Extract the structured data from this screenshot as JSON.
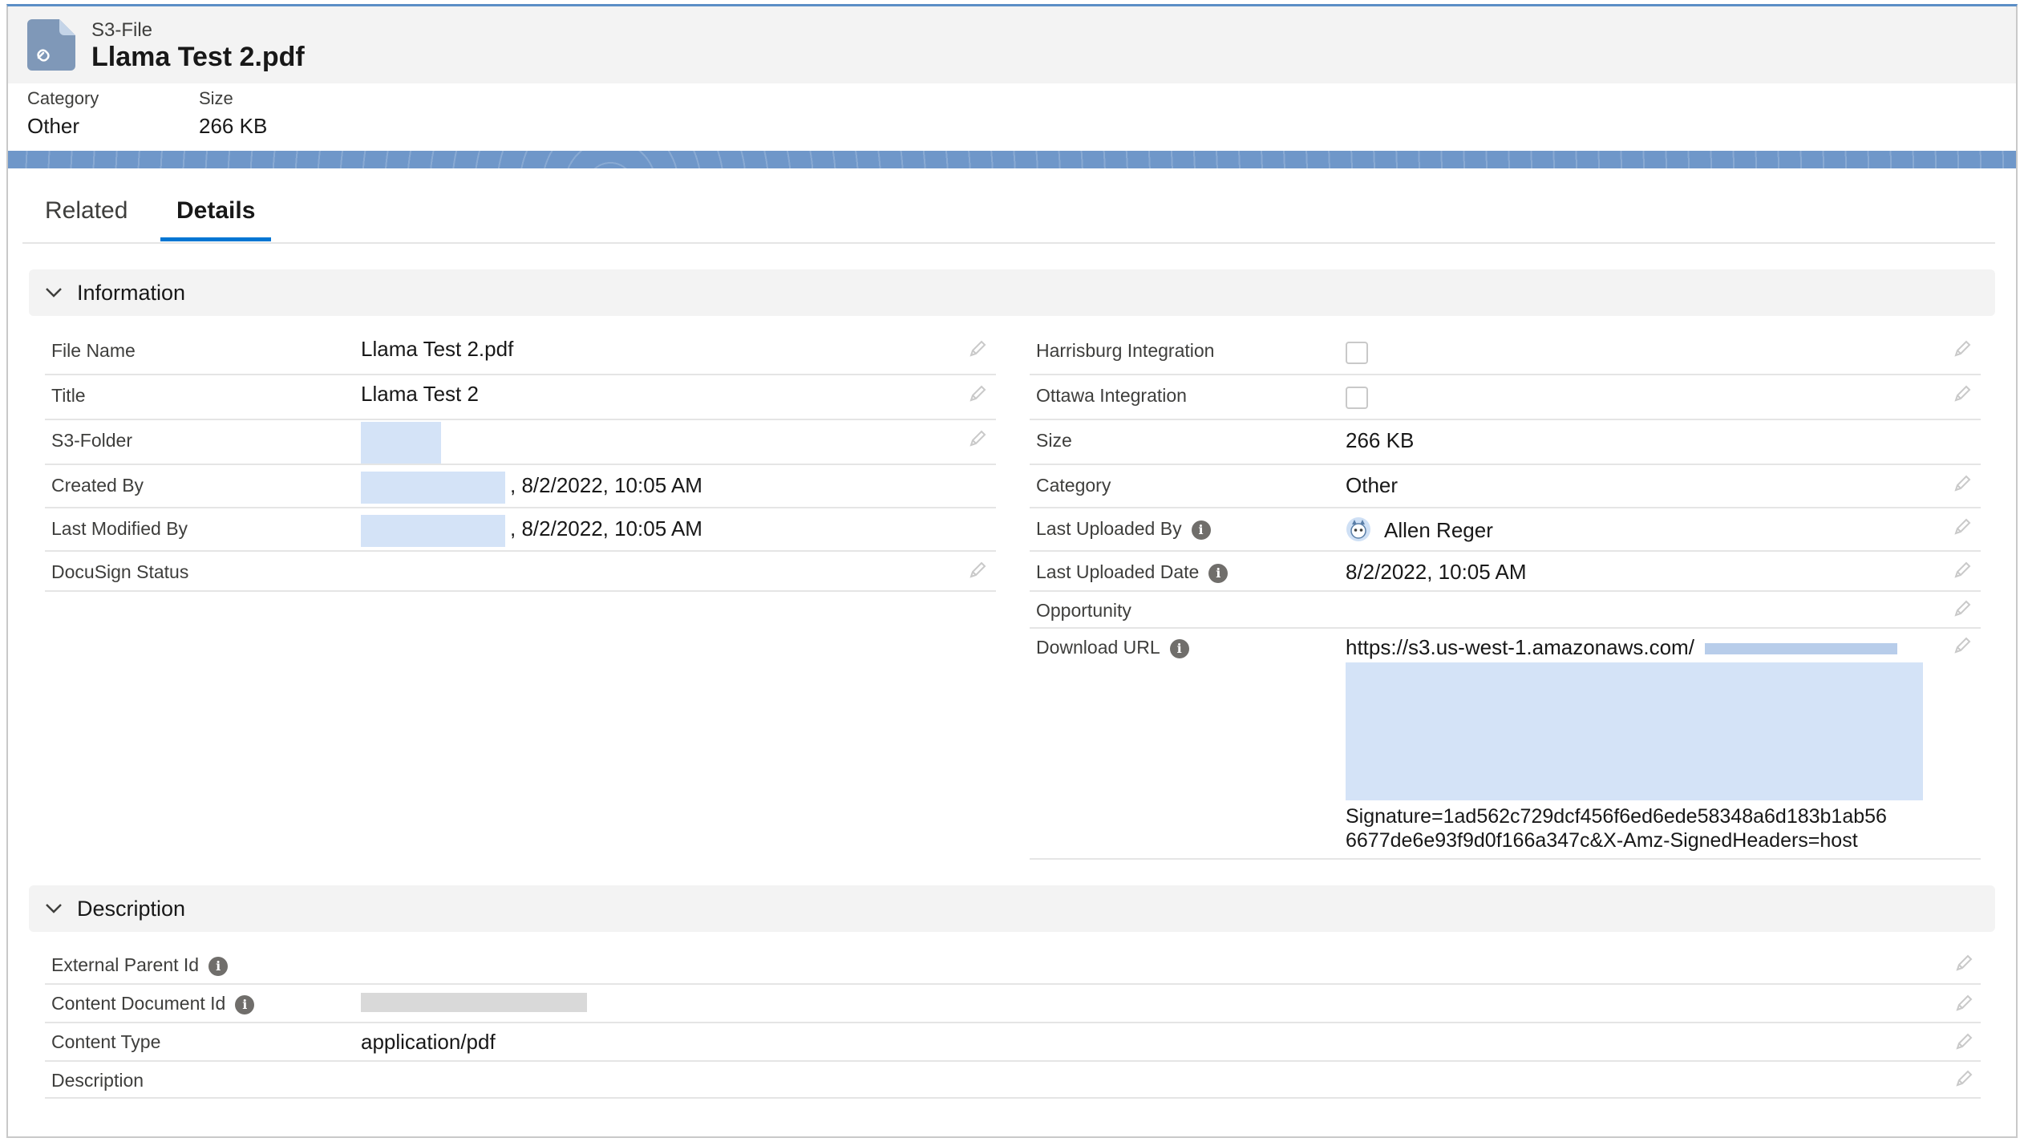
{
  "header": {
    "object_type": "S3-File",
    "title": "Llama Test 2.pdf",
    "highlights": [
      {
        "label": "Category",
        "value": "Other"
      },
      {
        "label": "Size",
        "value": "266 KB"
      }
    ]
  },
  "tabs": [
    {
      "label": "Related",
      "active": false
    },
    {
      "label": "Details",
      "active": true
    }
  ],
  "information": {
    "title": "Information",
    "left": [
      {
        "label": "File Name",
        "value": "Llama Test 2.pdf"
      },
      {
        "label": "Title",
        "value": "Llama Test 2"
      },
      {
        "label": "S3-Folder",
        "value": ""
      },
      {
        "label": "Created By",
        "value": ", 8/2/2022, 10:05 AM"
      },
      {
        "label": "Last Modified By",
        "value": ", 8/2/2022, 10:05 AM"
      },
      {
        "label": "DocuSign Status",
        "value": ""
      }
    ],
    "right": [
      {
        "label": "Harrisburg Integration",
        "value": ""
      },
      {
        "label": "Ottawa Integration",
        "value": ""
      },
      {
        "label": "Size",
        "value": "266 KB"
      },
      {
        "label": "Category",
        "value": "Other"
      },
      {
        "label": "Last Uploaded By",
        "value": "Allen Reger"
      },
      {
        "label": "Last Uploaded Date",
        "value": "8/2/2022, 10:05 AM"
      },
      {
        "label": "Opportunity",
        "value": ""
      },
      {
        "label": "Download URL",
        "value": "https://s3.us-west-1.amazonaws.com/",
        "value_end_1": "Signature=1ad562c729dcf456f6ed6ede58348a6d183b1ab56",
        "value_end_2": "6677de6e93f9d0f166a347c&X-Amz-SignedHeaders=host"
      }
    ]
  },
  "description": {
    "title": "Description",
    "rows": [
      {
        "label": "External Parent Id",
        "value": ""
      },
      {
        "label": "Content Document Id",
        "value": ""
      },
      {
        "label": "Content Type",
        "value": "application/pdf"
      },
      {
        "label": "Description",
        "value": ""
      }
    ]
  },
  "colors": {
    "accent": "#0176d3",
    "link": "#0b5cab",
    "banner": "#6f97c9"
  },
  "icons": [
    "file-link-icon",
    "chevron-down-icon",
    "pencil-icon",
    "info-icon",
    "avatar-icon"
  ]
}
